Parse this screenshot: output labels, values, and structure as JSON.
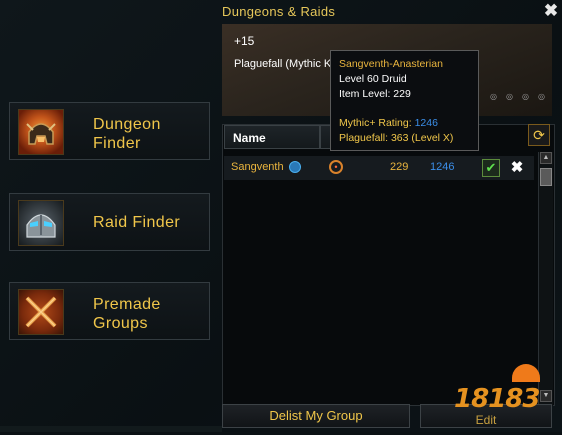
{
  "window": {
    "title": "Dungeons & Raids",
    "close_symbol": "✖"
  },
  "sidebar": {
    "items": [
      {
        "line1": "Dungeon",
        "line2": "Finder",
        "icon": "dungeon-helmet-icon"
      },
      {
        "line1": "Raid Finder",
        "line2": "",
        "icon": "raid-helmet-icon"
      },
      {
        "line1": "Premade",
        "line2": "Groups",
        "icon": "crossed-swords-icon"
      }
    ]
  },
  "banner": {
    "plus_level": "+15",
    "dungeon_text": "Plaguefall (Mythic K"
  },
  "list": {
    "header_name": "Name",
    "rows": [
      {
        "name": "Sangventh",
        "item_level": "229",
        "rating": "1246"
      }
    ]
  },
  "tooltip": {
    "name": "Sangventh-Anasterian",
    "level_class": "Level 60 Druid",
    "item_level": "Item Level: 229",
    "rating_label": "Mythic+ Rating:",
    "rating_value": "1246",
    "best_run": "Plaguefall: 363 (Level X)"
  },
  "buttons": {
    "delist": "Delist My Group",
    "edit": "Edit",
    "refresh_symbol": "⟳",
    "accept_symbol": "✔",
    "decline_symbol": "✖"
  },
  "watermark": {
    "text": "18183"
  },
  "colors": {
    "gold": "#f0c64a",
    "rating_blue": "#3b8ee8",
    "tooltip_name": "#eab53e"
  }
}
